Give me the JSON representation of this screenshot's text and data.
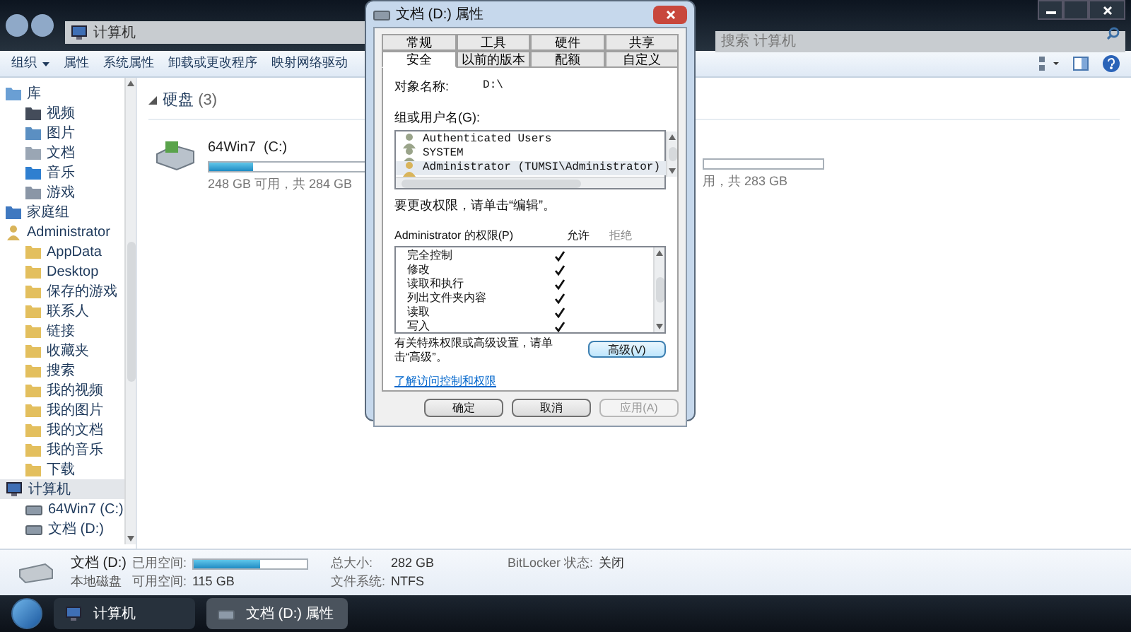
{
  "window": {
    "address": [
      "计算机"
    ],
    "search": {
      "placeholder": "搜索 计算机"
    }
  },
  "toolbar": {
    "organize": {
      "label": "组织"
    },
    "items": [
      "属性",
      "系统属性",
      "卸载或更改程序",
      "映射网络驱动"
    ]
  },
  "sidebar": {
    "items": [
      {
        "label": "库",
        "kind": "library",
        "selected": false,
        "children": [
          {
            "label": "视频",
            "kind": "video",
            "selected": false
          },
          {
            "label": "图片",
            "kind": "picture",
            "selected": false
          },
          {
            "label": "文档",
            "kind": "document",
            "selected": false
          },
          {
            "label": "音乐",
            "kind": "music",
            "selected": false
          },
          {
            "label": "游戏",
            "kind": "game",
            "selected": false
          }
        ]
      },
      {
        "label": "家庭组",
        "kind": "homegroup",
        "selected": false
      },
      {
        "label": "Administrator",
        "kind": "user",
        "selected": false,
        "children": [
          {
            "label": "AppData",
            "kind": "folder",
            "selected": false
          },
          {
            "label": "Desktop",
            "kind": "folder",
            "selected": false
          },
          {
            "label": "保存的游戏",
            "kind": "folder",
            "selected": false
          },
          {
            "label": "联系人",
            "kind": "folder",
            "selected": false
          },
          {
            "label": "链接",
            "kind": "folder",
            "selected": false
          },
          {
            "label": "收藏夹",
            "kind": "folder",
            "selected": false
          },
          {
            "label": "搜索",
            "kind": "folder",
            "selected": false
          },
          {
            "label": "我的视频",
            "kind": "folder",
            "selected": false
          },
          {
            "label": "我的图片",
            "kind": "folder",
            "selected": false
          },
          {
            "label": "我的文档",
            "kind": "folder",
            "selected": false
          },
          {
            "label": "我的音乐",
            "kind": "folder",
            "selected": false
          },
          {
            "label": "下载",
            "kind": "folder",
            "selected": false
          }
        ]
      },
      {
        "label": "计算机",
        "kind": "computer",
        "selected": true,
        "children": [
          {
            "label": "64Win7  (C:)",
            "kind": "drive",
            "selected": false
          },
          {
            "label": "文档 (D:)",
            "kind": "drive",
            "selected": false
          }
        ]
      }
    ]
  },
  "content": {
    "group": {
      "title": "硬盘",
      "count": "(3)",
      "expanded": true
    },
    "drives": [
      {
        "name": "64Win7  (C:)",
        "free_text": "248 GB 可用，共 284 GB",
        "level": 0.13
      },
      {
        "free_text": "用，共 283 GB"
      }
    ]
  },
  "details": {
    "name": "文档 (D:)",
    "type": "本地磁盘",
    "used_label": "已用空间:",
    "level": 0.59,
    "free_label": "可用空间:",
    "free": "115 GB",
    "total_label": "总大小:",
    "total": "282 GB",
    "fs_label": "文件系统:",
    "fs": "NTFS",
    "bitlocker_label": "BitLocker 状态:",
    "bitlocker": "关闭"
  },
  "taskbar": {
    "buttons": [
      {
        "label": "计算机",
        "kind": "computer",
        "selected": false
      },
      {
        "label": "文档 (D:) 属性",
        "kind": "drive",
        "selected": true
      }
    ]
  },
  "dialog": {
    "title": "文档 (D:) 属性",
    "tab_rows": [
      [
        {
          "label": "常规",
          "selected": false
        },
        {
          "label": "工具",
          "selected": false
        },
        {
          "label": "硬件",
          "selected": false
        },
        {
          "label": "共享",
          "selected": false
        }
      ],
      [
        {
          "label": "安全",
          "selected": true
        },
        {
          "label": "以前的版本",
          "selected": false
        },
        {
          "label": "配额",
          "selected": false
        },
        {
          "label": "自定义",
          "selected": false
        }
      ]
    ],
    "object_label": "对象名称:",
    "object_value": "D:\\",
    "users_label": "组或用户名(G):",
    "users": [
      {
        "name": "Authenticated Users",
        "kind": "group",
        "selected": false
      },
      {
        "name": "SYSTEM",
        "kind": "group",
        "selected": false
      },
      {
        "name": "Administrator (TUMSI\\Administrator)",
        "kind": "user",
        "selected": true
      }
    ],
    "edit_hint": "要更改权限，请单击“编辑”。",
    "perm_label": "Administrator 的权限(P)",
    "allow_label": "允许",
    "deny_label": "拒绝",
    "permissions": [
      {
        "name": "完全控制",
        "allow": true,
        "deny": false
      },
      {
        "name": "修改",
        "allow": true,
        "deny": false
      },
      {
        "name": "读取和执行",
        "allow": true,
        "deny": false
      },
      {
        "name": "列出文件夹内容",
        "allow": true,
        "deny": false
      },
      {
        "name": "读取",
        "allow": true,
        "deny": false
      },
      {
        "name": "写入",
        "allow": true,
        "deny": false
      }
    ],
    "advanced_hint": "有关特殊权限或高级设置，请单击“高级”。",
    "advanced_button": "高级(V)",
    "link": "了解访问控制和权限",
    "buttons": [
      {
        "label": "确定",
        "disabled": false
      },
      {
        "label": "取消",
        "disabled": false
      },
      {
        "label": "应用(A)",
        "disabled": true
      }
    ]
  }
}
